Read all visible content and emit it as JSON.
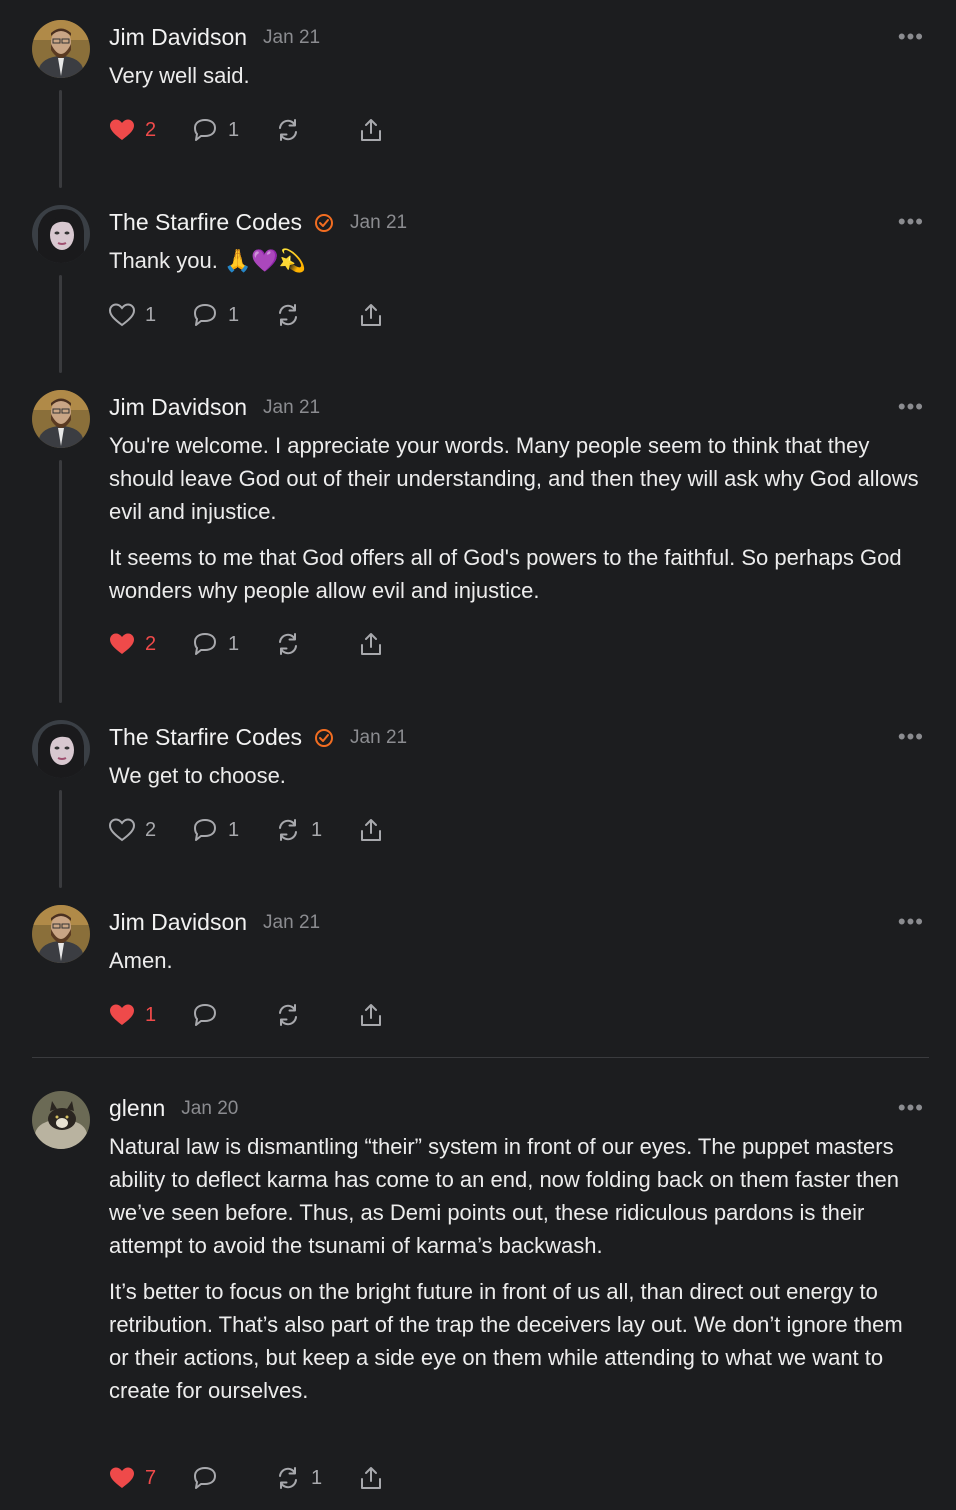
{
  "comments": [
    {
      "author": "Jim Davidson",
      "date": "Jan 21",
      "verified": false,
      "avatar": "bearded-man-avatar",
      "paragraphs": [
        "Very well said."
      ],
      "likes": "2",
      "liked": true,
      "replies": "1",
      "restacks": ""
    },
    {
      "author": "The Starfire Codes",
      "date": "Jan 21",
      "verified": true,
      "avatar": "woman-avatar",
      "paragraphs": [
        "Thank you. 🙏💜💫"
      ],
      "likes": "1",
      "liked": false,
      "replies": "1",
      "restacks": ""
    },
    {
      "author": "Jim Davidson",
      "date": "Jan 21",
      "verified": false,
      "avatar": "bearded-man-avatar",
      "paragraphs": [
        "You're welcome. I appreciate your words. Many people seem to think that they should leave God out of their understanding, and then they will ask why God allows evil and injustice.",
        "It seems to me that God offers all of God's powers to the faithful. So perhaps God wonders why people allow evil and injustice."
      ],
      "likes": "2",
      "liked": true,
      "replies": "1",
      "restacks": ""
    },
    {
      "author": "The Starfire Codes",
      "date": "Jan 21",
      "verified": true,
      "avatar": "woman-avatar",
      "paragraphs": [
        "We get to choose."
      ],
      "likes": "2",
      "liked": false,
      "replies": "1",
      "restacks": "1"
    },
    {
      "author": "Jim Davidson",
      "date": "Jan 21",
      "verified": false,
      "avatar": "bearded-man-avatar",
      "paragraphs": [
        "Amen."
      ],
      "likes": "1",
      "liked": true,
      "replies": "",
      "restacks": ""
    },
    {
      "author": "glenn",
      "date": "Jan 20",
      "verified": false,
      "avatar": "cat-avatar",
      "paragraphs": [
        "Natural law is dismantling “their” system in front of our eyes. The puppet masters ability to deflect karma has come to an end, now folding back on them faster then we’ve seen before. Thus, as Demi points out, these ridiculous pardons is their attempt to avoid the tsunami of karma’s backwash.",
        "It’s better to focus on the bright future in front of us all, than direct out energy to retribution. That’s also part of the trap the deceivers lay out. We don’t ignore them or their actions, but keep a side eye on them while attending to what we want to create for ourselves."
      ],
      "likes": "7",
      "liked": true,
      "replies": "",
      "restacks": "1"
    }
  ],
  "more_label": "•••",
  "colors": {
    "background": "#1c1d1f",
    "like_active": "#ef4a4a",
    "verified_badge": "#f26d21",
    "muted": "#8b8c90"
  }
}
